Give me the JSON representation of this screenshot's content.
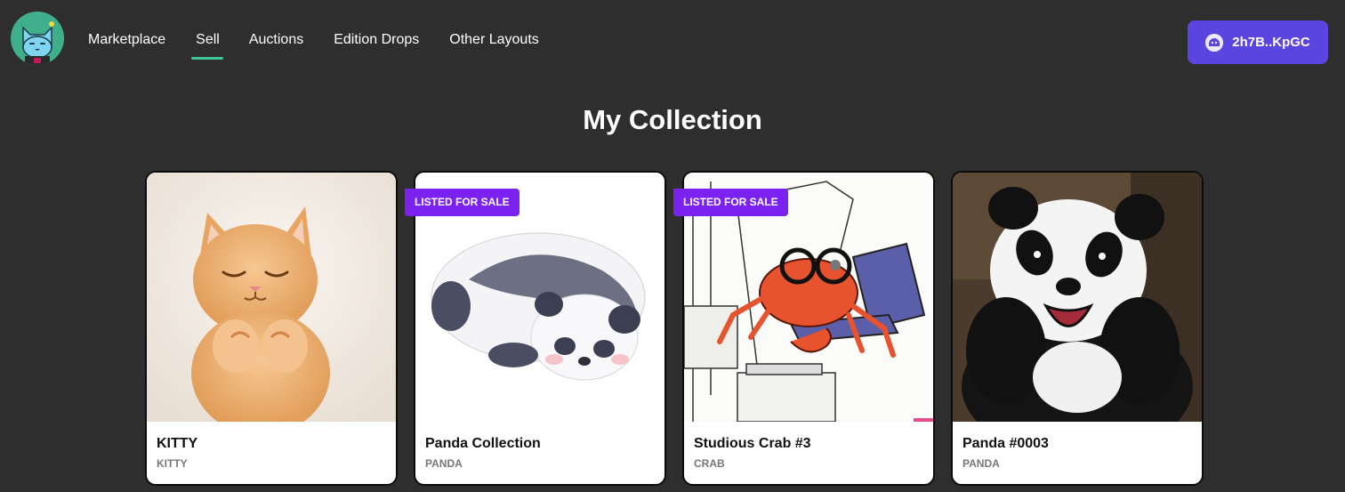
{
  "nav": {
    "items": [
      {
        "label": "Marketplace",
        "active": false
      },
      {
        "label": "Sell",
        "active": true
      },
      {
        "label": "Auctions",
        "active": false
      },
      {
        "label": "Edition Drops",
        "active": false
      },
      {
        "label": "Other Layouts",
        "active": false
      }
    ]
  },
  "wallet": {
    "address": "2h7B..KpGC",
    "icon": "phantom-ghost-icon",
    "color": "#5a45e0"
  },
  "page": {
    "title": "My Collection"
  },
  "badge": {
    "color": "#7b22f0"
  },
  "cards": [
    {
      "name": "KITTY",
      "collection": "KITTY",
      "badge": "",
      "image": "orange-kitten"
    },
    {
      "name": "Panda Collection",
      "collection": "PANDA",
      "badge": "LISTED FOR SALE",
      "image": "sleeping-panda-illustration"
    },
    {
      "name": "Studious Crab #3",
      "collection": "CRAB",
      "badge": "LISTED FOR SALE",
      "image": "crab-with-glasses-drawing"
    },
    {
      "name": "Panda #0003",
      "collection": "PANDA",
      "badge": "",
      "image": "happy-panda-photo"
    }
  ]
}
